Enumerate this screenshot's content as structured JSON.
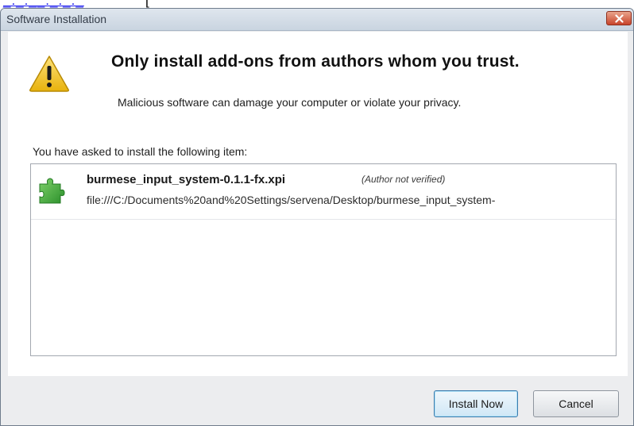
{
  "page": {
    "link_text": "_._.__._._._",
    "link_tail": "["
  },
  "dialog": {
    "title": "Software Installation",
    "headline": "Only install add-ons from authors whom you trust.",
    "subline": "Malicious software can damage your computer or violate your privacy.",
    "prompt": "You have asked to install the following item:",
    "items": [
      {
        "name": "burmese_input_system-0.1.1-fx.xpi",
        "note": "(Author not verified)",
        "url": "file:///C:/Documents%20and%20Settings/servena/Desktop/burmese_input_system-",
        "icon": "puzzle-piece-icon"
      }
    ],
    "buttons": {
      "install": "Install Now",
      "cancel": "Cancel"
    },
    "icons": {
      "warning": "warning-triangle-icon",
      "close": "close-icon"
    },
    "colors": {
      "close_button": "#c8442b",
      "warning_fill": "#f5c518",
      "puzzle_green": "#3aa43a",
      "default_button_border": "#3d7bad"
    }
  }
}
